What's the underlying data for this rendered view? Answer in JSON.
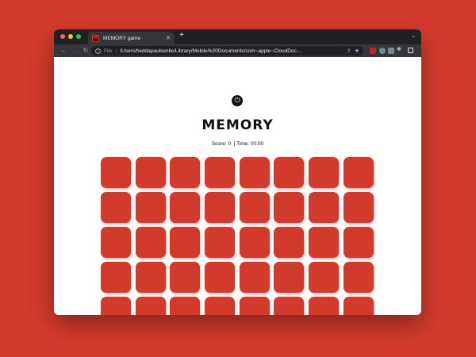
{
  "browser": {
    "tab_title": "MEMORY game",
    "tab_favicon_letter": "M",
    "tab_close": "✕",
    "new_tab": "+",
    "tab_menu": "⌄",
    "scheme_label": "File",
    "url": "/Users/heddapaulsenlie/Library/Mobile%20Documents/com~apple~CloudDoc…",
    "nav": {
      "back": "←",
      "forward": "→",
      "reload": "↻"
    },
    "icons": [
      "info-icon",
      "share-icon",
      "bookmark-star-icon",
      "extension-icon",
      "puzzle-icon",
      "sidebar-icon",
      "profile-icon",
      "kebab-menu-icon"
    ]
  },
  "game": {
    "restart_icon": "⏻",
    "title": "MEMORY",
    "score_label": "Score:",
    "score_value": "0",
    "time_label": "| Time:",
    "time_value": "00:00",
    "rows": 5,
    "cols": 8,
    "card_color": "#d23a2c"
  },
  "colors": {
    "background": "#d23a2c",
    "title": "#111111",
    "page": "#ffffff"
  }
}
